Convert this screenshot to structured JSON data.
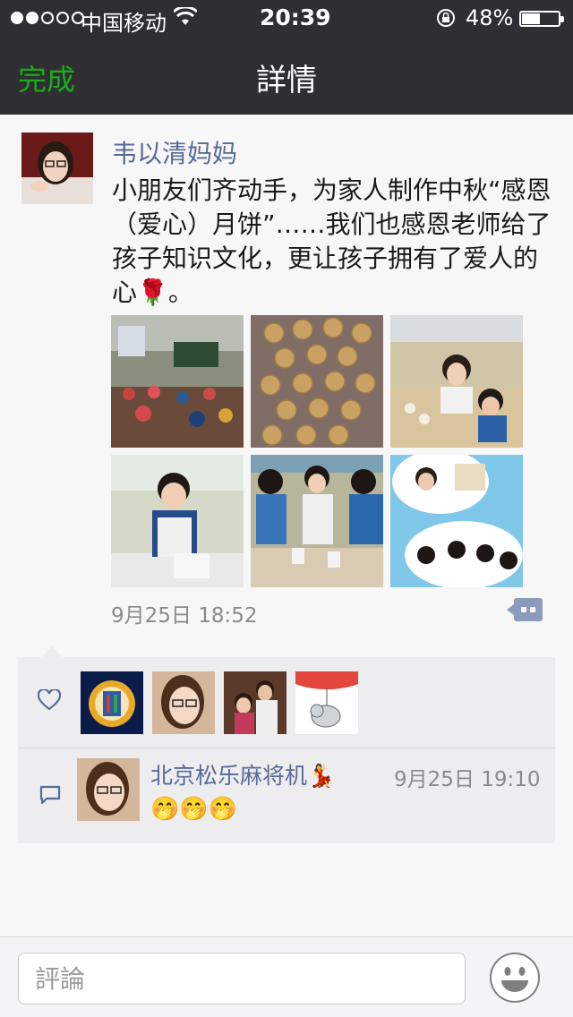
{
  "status_bar": {
    "carrier": "中国移动",
    "time": "20:39",
    "battery_percent": "48%",
    "battery_level": 0.48,
    "signal_bars_filled": 2,
    "signal_bars_total": 5
  },
  "nav": {
    "done_label": "完成",
    "title": "詳情"
  },
  "post": {
    "author": "韦以清妈妈",
    "text": "小朋友们齐动手，为家人制作中秋“感恩（爱心）月饼”……我们也感恩老师给了孩子知识文化，更让孩子拥有了爱人的心🌹。",
    "timestamp": "9月25日 18:52"
  },
  "comment": {
    "author": "北京松乐麻将机💃",
    "time": "9月25日 19:10",
    "text": "🤭🤭🤭"
  },
  "input": {
    "placeholder": "評論"
  },
  "colors": {
    "nav_bg": "#2f2f33",
    "accent_green": "#1aad19",
    "link_blue": "#576b95",
    "meta_gray": "#8a8a8a"
  },
  "icons": [
    "wifi-icon",
    "orientation-lock-icon",
    "battery-icon",
    "heart-icon",
    "comment-icon",
    "more-options-icon",
    "emoji-icon"
  ]
}
